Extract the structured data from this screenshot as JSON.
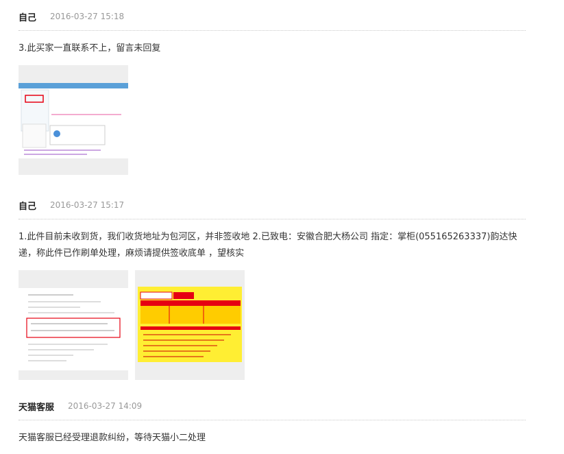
{
  "messages": [
    {
      "author": "自己",
      "time": "2016-03-27 15:18",
      "text": "3.此买家一直联系不上，留言未回复"
    },
    {
      "author": "自己",
      "time": "2016-03-27 15:17",
      "text": "1.此件目前未收到货，我们收货地址为包河区，并非签收地 2.已致电：安徽合肥大杨公司 指定：掌柜(055165263337)韵达快递，称此件已作刷单处理，麻烦请提供签收底单 ，望核实"
    },
    {
      "author": "天猫客服",
      "time": "2016-03-27 14:09",
      "text": "天猫客服已经受理退款纠纷，等待天猫小二处理"
    }
  ],
  "colors": {
    "accent_red": "#e60012",
    "yellow": "#ffee33",
    "gray_bg": "#eeeeee"
  }
}
